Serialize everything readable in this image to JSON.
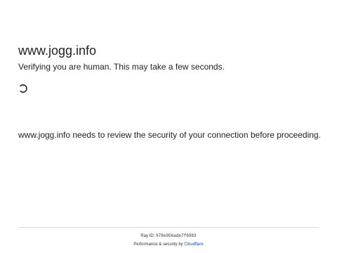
{
  "page": {
    "site_domain": "www.jogg.info",
    "subtitle": "Verifying you are human. This may take a few seconds.",
    "security_message": "www.jogg.info needs to review the security of your connection before proceeding."
  },
  "spinner": {
    "icon": "loading-spinner-icon"
  },
  "footer": {
    "ray_label": "Ray ID: ",
    "ray_id": "978e956ade7f6983",
    "performance_label": "Performance & security by ",
    "provider_link": "Cloudflare",
    "link_color": "#0051c3"
  }
}
